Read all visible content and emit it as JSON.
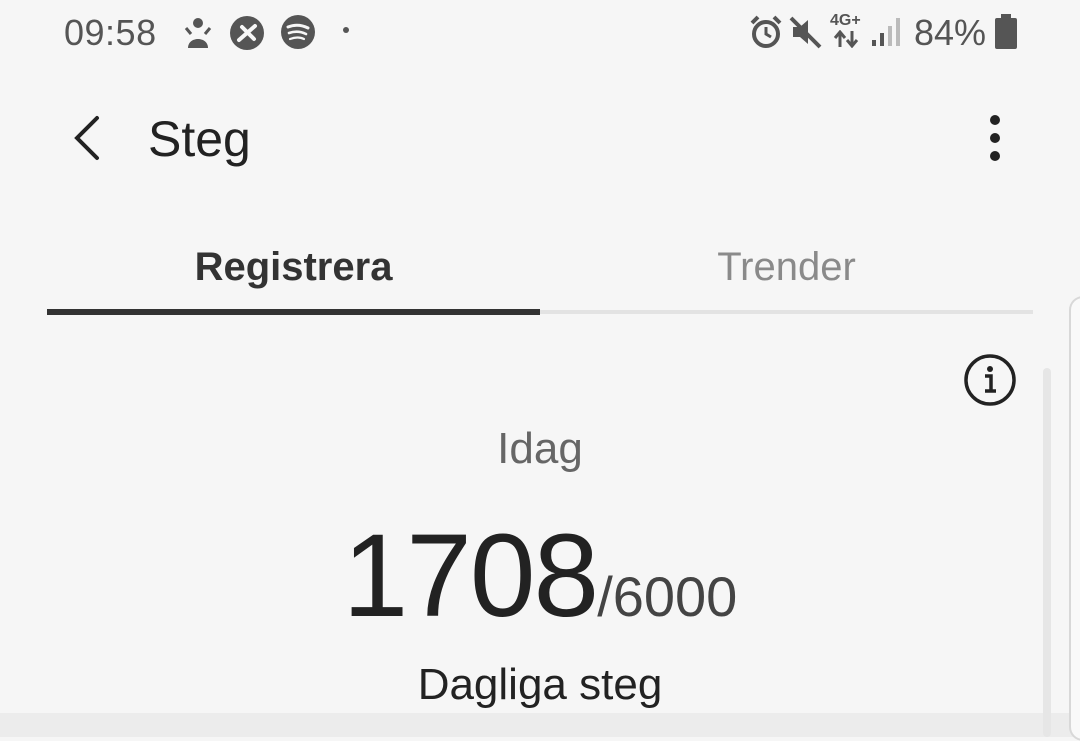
{
  "status_bar": {
    "time": "09:58",
    "battery_percent": "84%",
    "network_label": "4G+",
    "notification_icons": [
      "pokemon-go-icon",
      "geocaching-icon",
      "spotify-icon",
      "dot-icon"
    ],
    "system_icons": [
      "alarm-icon",
      "mute-icon",
      "data-arrows-icon",
      "signal-icon",
      "battery-icon"
    ]
  },
  "app_bar": {
    "title": "Steg",
    "back_icon": "chevron-left-icon",
    "more_icon": "more-vertical-icon"
  },
  "tabs": [
    {
      "label": "Registrera",
      "active": true
    },
    {
      "label": "Trender",
      "active": false
    }
  ],
  "summary": {
    "info_icon": "info-icon",
    "period_label": "Idag",
    "steps": "1708",
    "goal": "/6000",
    "caption": "Dagliga steg"
  }
}
